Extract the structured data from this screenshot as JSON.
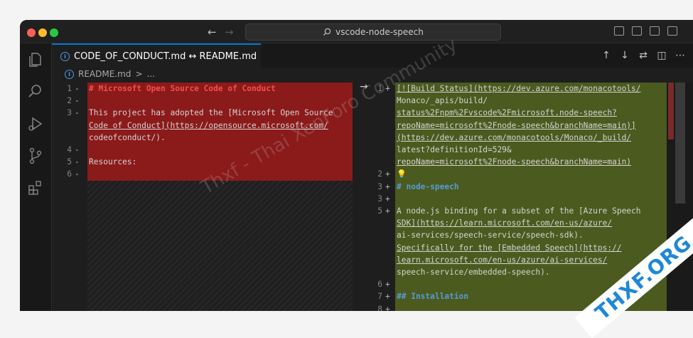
{
  "window": {
    "traffic_colors": [
      "#ff5f57",
      "#febc2e",
      "#28c840"
    ],
    "command_center": "vscode-node-speech"
  },
  "tab": {
    "title": "CODE_OF_CONDUCT.md ↔ README.md"
  },
  "breadcrumb": {
    "file": "README.md",
    "sep": ">",
    "rest": "..."
  },
  "left_lines": [
    {
      "n": "1",
      "m": "-",
      "text": "# Microsoft Open Source Code of Conduct"
    },
    {
      "n": "2",
      "m": "-",
      "text": ""
    },
    {
      "n": "3",
      "m": "-",
      "text": "This project has adopted the [Microsoft Open Source"
    },
    {
      "n": "",
      "m": "",
      "text": "Code of Conduct](https://opensource.microsoft.com/"
    },
    {
      "n": "",
      "m": "",
      "text": "codeofconduct/)."
    },
    {
      "n": "4",
      "m": "-",
      "text": ""
    },
    {
      "n": "5",
      "m": "-",
      "text": "Resources:"
    },
    {
      "n": "6",
      "m": "-",
      "text": ""
    }
  ],
  "right_lines": [
    {
      "n": "1",
      "m": "+",
      "text": "[![Build Status](https://dev.azure.com/monacotools/"
    },
    {
      "n": "",
      "m": "",
      "text": "Monaco/_apis/build/"
    },
    {
      "n": "",
      "m": "",
      "text": "status%2Fnpm%2Fvscode%2Fmicrosoft.node-speech?"
    },
    {
      "n": "",
      "m": "",
      "text": "repoName=microsoft%2Fnode-speech&branchName=main)]"
    },
    {
      "n": "",
      "m": "",
      "text": "(https://dev.azure.com/monacotools/Monaco/_build/"
    },
    {
      "n": "",
      "m": "",
      "text": "latest?definitionId=529&"
    },
    {
      "n": "",
      "m": "",
      "text": "repoName=microsoft%2Fnode-speech&branchName=main)"
    },
    {
      "n": "2",
      "m": "+",
      "text": "💡"
    },
    {
      "n": "3",
      "m": "+",
      "text": "# node-speech"
    },
    {
      "n": "3",
      "m": "+",
      "text": ""
    },
    {
      "n": "5",
      "m": "+",
      "text": "A node.js binding for a subset of the [Azure Speech"
    },
    {
      "n": "",
      "m": "",
      "text": "SDK](https://learn.microsoft.com/en-us/azure/"
    },
    {
      "n": "",
      "m": "",
      "text": "ai-services/speech-service/speech-sdk)."
    },
    {
      "n": "",
      "m": "",
      "text": "Specifically for the [Embedded Speech](https://"
    },
    {
      "n": "",
      "m": "",
      "text": "learn.microsoft.com/en-us/azure/ai-services/"
    },
    {
      "n": "",
      "m": "",
      "text": "speech-service/embedded-speech)."
    },
    {
      "n": "6",
      "m": "+",
      "text": ""
    },
    {
      "n": "7",
      "m": "+",
      "text": "## Installation"
    },
    {
      "n": "8",
      "m": "+",
      "text": ""
    }
  ],
  "overlay": {
    "watermark": "Thxf - Thai XenForo Community",
    "badge": "THXF.ORG"
  }
}
